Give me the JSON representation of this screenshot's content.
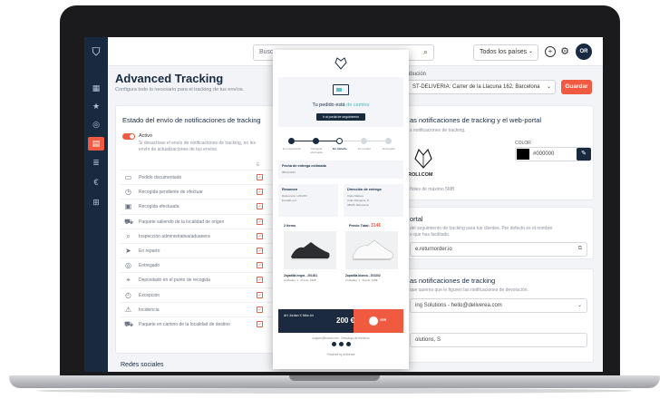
{
  "sidebar": {
    "items": [
      {
        "icon": "dashboard-icon",
        "glyph": "▦"
      },
      {
        "icon": "star-icon",
        "glyph": "★"
      },
      {
        "icon": "compass-icon",
        "glyph": "◎"
      },
      {
        "icon": "tracking-icon",
        "glyph": "▤"
      },
      {
        "icon": "layers-icon",
        "glyph": "≣"
      },
      {
        "icon": "euro-icon",
        "glyph": "€"
      },
      {
        "icon": "add-box-icon",
        "glyph": "⊞"
      }
    ]
  },
  "topbar": {
    "search_placeholder": "Busca",
    "country_select": "Todos los países",
    "avatar_initials": "OR"
  },
  "page": {
    "title": "Advanced Tracking",
    "subtitle": "Configura todo lo necesario para el tracking de tus envíos."
  },
  "distribution": {
    "label": "ribución",
    "value": "ST-DELIVERIA: Carrer de la Llacuna 162, Barcelona",
    "save_label": "Guardar"
  },
  "left_card": {
    "title": "Estado del envío de notificaciones de tracking",
    "toggle_label": "Activo",
    "description_1": "Si desactivas el envío de notificaciones de tracking, no les",
    "description_2": "envío de actualizaciones de tus envíos.",
    "column_header": "E",
    "statuses": [
      {
        "label": "Pedido documentado",
        "icon": "document-icon",
        "glyph": "▭"
      },
      {
        "label": "Recogida pendiente de efectuar",
        "icon": "clock-icon",
        "glyph": "◷"
      },
      {
        "label": "Recogida efectuada",
        "icon": "box-icon",
        "glyph": "▣"
      },
      {
        "label": "Paquete saliendo de la localidad de origen",
        "icon": "truck-icon",
        "glyph": "⛟"
      },
      {
        "label": "Inspección administrativa/aduanera",
        "icon": "search-icon",
        "glyph": "⌕"
      },
      {
        "label": "En reparto",
        "icon": "delivery-icon",
        "glyph": "➤"
      },
      {
        "label": "Entregado",
        "icon": "check-circle-icon",
        "glyph": "◎"
      },
      {
        "label": "Depositado en el punto de recogida",
        "icon": "location-icon",
        "glyph": "⌖"
      },
      {
        "label": "Excepción",
        "icon": "exception-icon",
        "glyph": "◴"
      },
      {
        "label": "Incidencia",
        "icon": "warning-icon",
        "glyph": "⚠"
      },
      {
        "label": "Paquete en camino de la localidad de destino",
        "icon": "truck-icon",
        "glyph": "⛟"
      }
    ],
    "check_glyph": "✓"
  },
  "bottom_title": "Redes sociales",
  "right_card1": {
    "title": "as notificaciones de tracking y el web-portal",
    "subtitle": "s notificaciones de tracking.",
    "color_label": "COLOR",
    "color_value": "#000000",
    "logo_text": "ROLI.COM",
    "logo_note": "ñoles de máximo 5MB"
  },
  "right_card2": {
    "title": "ortal",
    "description_1": "del seguimiento de tracking para tus clientes. Por defecto es el nombre",
    "description_2": "o que has facilitado.",
    "url_value": "e.returnorder.io"
  },
  "right_card3": {
    "title": "as notificaciones de tracking",
    "description": "que quieres que le figuren las notificaciones de devolución.",
    "sender_value": "ing Solutions - hello@deliverea.com",
    "second_value": "olutions, S"
  },
  "email_preview": {
    "headline_prefix": "Tu pedido está",
    "headline_highlight": "de camino",
    "cta": "Ir al portal de seguimiento",
    "steps": [
      "En preparación",
      "Recogida efectuada",
      "En tránsito",
      "En reparto",
      "Entregado"
    ],
    "delivery_title": "Fecha de entrega estimada",
    "delivery_value": "08/11/2024",
    "summary_title": "Resumen",
    "summary_lines": [
      "Referencia: 1234973",
      "Enviado por:"
    ],
    "address_title": "Dirección de entrega",
    "address_lines": [
      "Clara Mateus",
      "Calle Zaragoza, 8",
      "08025, Barcelona"
    ],
    "items_label": "2 Items",
    "total_label": "Precio Total:",
    "total_value": "314€",
    "product_1": "Zapatilla negra - 201301",
    "product_1_detail": "Unidades: 1 · Precio: 169€",
    "product_2": "Zapatilla blanca - 201302",
    "product_2_detail": "Unidades: 1 · Precio: 145€",
    "banner_text": "AH Jordan X Nike Air",
    "banner_price": "200 €",
    "banner_btn": "VER",
    "footer_links": "support@brand.com  ·  Descarga de términos",
    "powered_by": "Powered by deliverea"
  }
}
